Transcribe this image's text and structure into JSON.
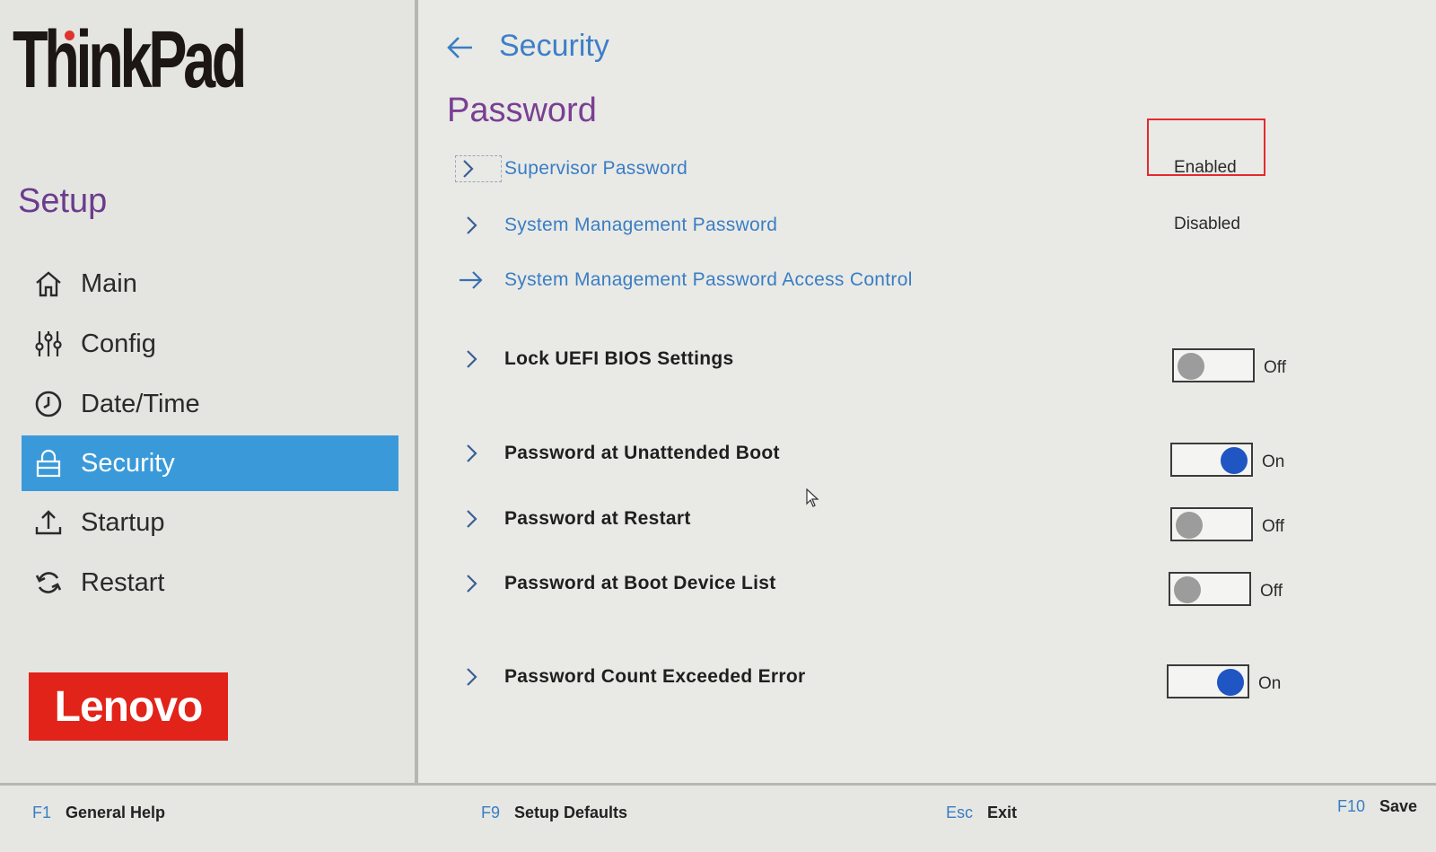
{
  "brand": {
    "thinkpad": "ThinkPad",
    "lenovo": "Lenovo"
  },
  "sidebar": {
    "title": "Setup",
    "items": [
      {
        "label": "Main",
        "icon": "home-icon",
        "active": false
      },
      {
        "label": "Config",
        "icon": "sliders-icon",
        "active": false
      },
      {
        "label": "Date/Time",
        "icon": "clock-icon",
        "active": false
      },
      {
        "label": "Security",
        "icon": "lock-icon",
        "active": true
      },
      {
        "label": "Startup",
        "icon": "upload-icon",
        "active": false
      },
      {
        "label": "Restart",
        "icon": "restart-icon",
        "active": false
      }
    ]
  },
  "main": {
    "breadcrumb": "Security",
    "section_title": "Password",
    "rows": [
      {
        "label": "Supervisor Password",
        "status": "Enabled",
        "kind": "link"
      },
      {
        "label": "System Management Password",
        "status": "Disabled",
        "kind": "link"
      },
      {
        "label": "System Management Password Access Control",
        "kind": "link-arrow"
      },
      {
        "label": "Lock UEFI BIOS Settings",
        "toggle": "Off",
        "kind": "toggle"
      },
      {
        "label": "Password at Unattended Boot",
        "toggle": "On",
        "kind": "toggle"
      },
      {
        "label": "Password at Restart",
        "toggle": "Off",
        "kind": "toggle"
      },
      {
        "label": "Password at Boot Device List",
        "toggle": "Off",
        "kind": "toggle"
      },
      {
        "label": "Password Count Exceeded Error",
        "toggle": "On",
        "kind": "toggle"
      }
    ]
  },
  "footer": {
    "keys": [
      {
        "key": "F1",
        "label": "General Help"
      },
      {
        "key": "F9",
        "label": "Setup Defaults"
      },
      {
        "key": "Esc",
        "label": "Exit"
      },
      {
        "key": "F10",
        "label": "Save"
      }
    ]
  },
  "colors": {
    "accent": "#3a9ad9",
    "link": "#3a7dc4",
    "title_purple": "#7a3f93",
    "toggle_on": "#1f56c4",
    "highlight_box": "#e32a2f",
    "lenovo_red": "#e2231a"
  }
}
